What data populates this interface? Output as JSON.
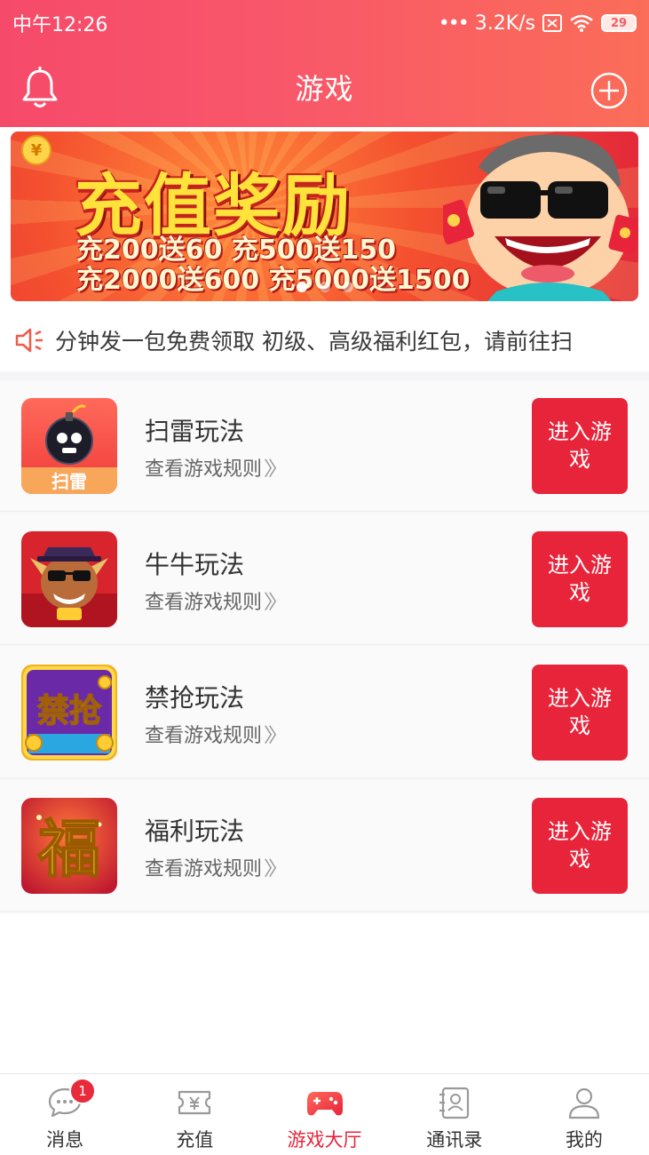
{
  "status_bar": {
    "time": "中午12:26",
    "network_speed": "3.2K/s",
    "battery": "29"
  },
  "header": {
    "title": "游戏",
    "left_icon": "bell-icon",
    "right_icon": "plus-circle-icon"
  },
  "banner": {
    "title": "充值奖励",
    "line1": "充200送60  充500送150",
    "line2": "充2000送600  充5000送1500",
    "slide_count": 3,
    "active_slide": 1
  },
  "notice": {
    "icon": "speaker-icon",
    "text": "分钟发一包免费领取 初级、高级福利红包，请前往扫"
  },
  "games": [
    {
      "name": "扫雷玩法",
      "rule_link": "查看游戏规则",
      "button_label": "进入游戏",
      "icon_label": "扫雷"
    },
    {
      "name": "牛牛玩法",
      "rule_link": "查看游戏规则",
      "button_label": "进入游戏"
    },
    {
      "name": "禁抢玩法",
      "rule_link": "查看游戏规则",
      "button_label": "进入游戏",
      "icon_label": "禁抢"
    },
    {
      "name": "福利玩法",
      "rule_link": "查看游戏规则",
      "button_label": "进入游戏",
      "icon_label": "福"
    }
  ],
  "bottom_nav": [
    {
      "label": "消息",
      "icon": "message-icon",
      "badge": "1"
    },
    {
      "label": "充值",
      "icon": "ticket-icon"
    },
    {
      "label": "游戏大厅",
      "icon": "gamepad-icon",
      "active": true
    },
    {
      "label": "通讯录",
      "icon": "contacts-icon"
    },
    {
      "label": "我的",
      "icon": "profile-icon"
    }
  ],
  "colors": {
    "header_start": "#f64a6a",
    "header_end": "#fb6d58",
    "accent_red": "#e8243a"
  }
}
